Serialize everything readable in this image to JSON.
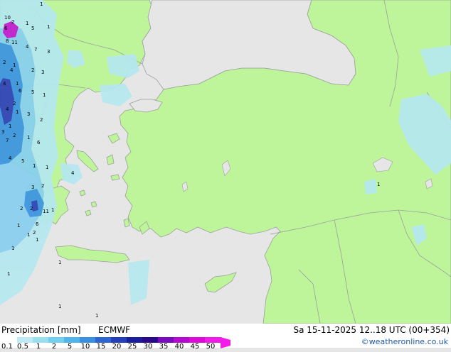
{
  "footer": {
    "title": "Precipitation [mm]",
    "model": "ECMWF",
    "valid": "Sa 15-11-2025 12..18 UTC (00+354)",
    "credit": "©weatheronline.co.uk"
  },
  "legend": {
    "ticks": [
      "0.1",
      "0.5",
      "1",
      "2",
      "5",
      "10",
      "15",
      "20",
      "25",
      "30",
      "35",
      "40",
      "45",
      "50"
    ],
    "colors": [
      "#ffffff",
      "#bfe9f5",
      "#99dff0",
      "#73cff0",
      "#4fb5ec",
      "#3a8fe0",
      "#2f65d2",
      "#243ebc",
      "#1b1e9c",
      "#2a0a8a",
      "#7a0abf",
      "#b40ad0",
      "#dd0ad9",
      "#f21ae8"
    ]
  },
  "map": {
    "colors": {
      "sea": "#e6e6e6",
      "land": "#bff59a",
      "border": "#9aa09a",
      "precip_light": "#b5e8f0",
      "precip_mid": "#87cfee",
      "precip_heavy": "#3b93e2",
      "precip_very_heavy": "#2d3fb8",
      "precip_extreme": "#c21ad2"
    },
    "point_labels": [
      "10",
      "1",
      "6",
      "2",
      "1",
      "5",
      "1",
      "11",
      "8",
      "4",
      "7",
      "3",
      "2",
      "1",
      "4",
      "2",
      "3",
      "4",
      "1",
      "6",
      "5",
      "1",
      "2",
      "4",
      "1",
      "3",
      "2",
      "1",
      "3",
      "2",
      "7",
      "1",
      "6",
      "4",
      "5",
      "1",
      "1",
      "4",
      "3",
      "2",
      "2",
      "11",
      "1",
      "2",
      "6",
      "1",
      "2",
      "1",
      "1",
      "1",
      "1",
      "1",
      "1",
      "1",
      "1"
    ]
  }
}
